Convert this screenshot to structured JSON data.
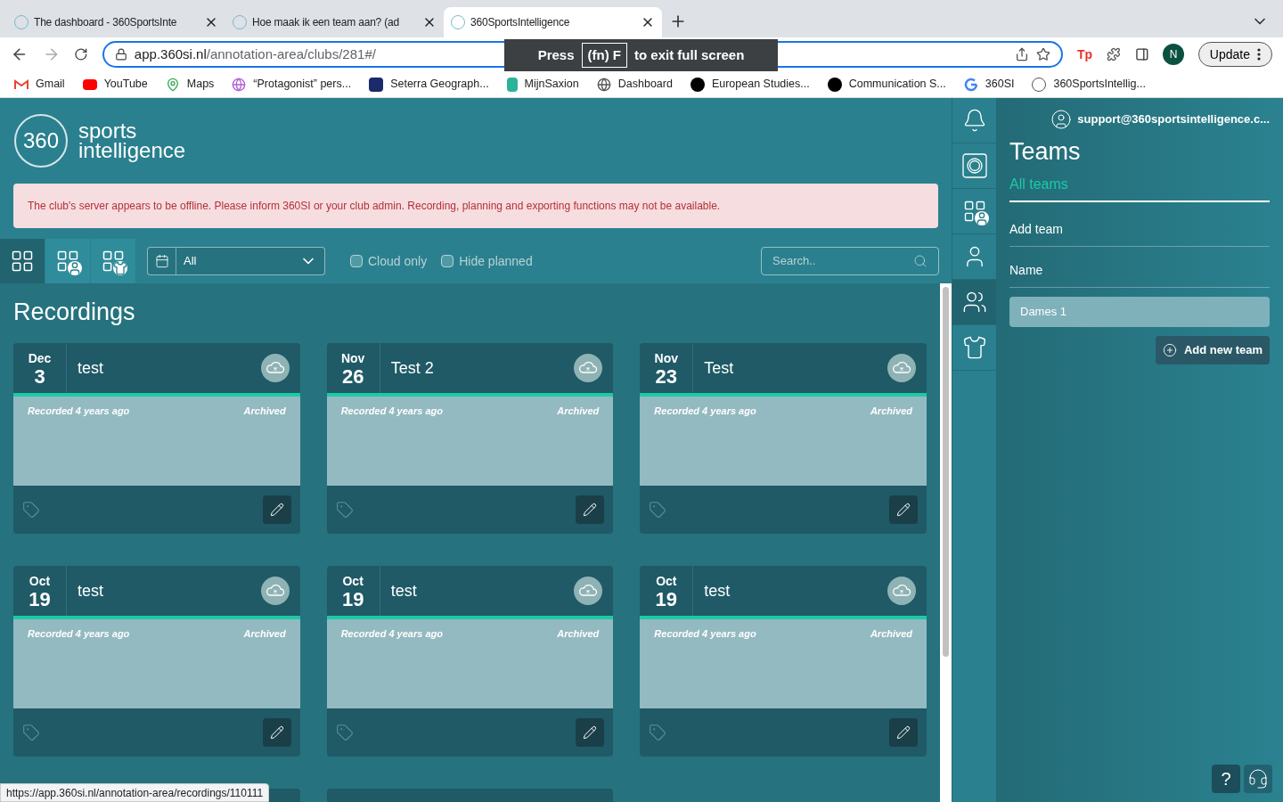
{
  "browser": {
    "tabs": [
      {
        "title": "The dashboard - 360SportsInte",
        "selected": false
      },
      {
        "title": "Hoe maak ik een team aan? (ad",
        "selected": false
      },
      {
        "title": "360SportsIntelligence",
        "selected": true
      }
    ],
    "address": {
      "host": "app.360si.nl",
      "path": "/annotation-area/clubs/281#/"
    },
    "profile": "N",
    "update": "Update",
    "tp": "Tp",
    "bookmarks": [
      "Gmail",
      "YouTube",
      "Maps",
      "“Protagonist” pers...",
      "Seterra Geograph...",
      "MijnSaxion",
      "Dashboard",
      "European Studies...",
      "Communication S...",
      "360SI",
      "360SportsIntellig..."
    ],
    "fullscreen_toast": {
      "before": "Press",
      "key": "(fn) F",
      "after": "to exit full screen"
    },
    "status_url": "https://app.360si.nl/annotation-area/recordings/110111"
  },
  "logo": {
    "mark": "360",
    "line1": "sports",
    "line2": "intelligence"
  },
  "alert": "The club's server appears to be offline. Please inform 360SI or your club admin. Recording, planning and exporting functions may not be available.",
  "view_buttons": [
    {
      "kind": "grid",
      "selected": true
    },
    {
      "kind": "players",
      "selected": false
    },
    {
      "kind": "teams",
      "selected": false
    }
  ],
  "period_select": {
    "value": "All"
  },
  "filters": [
    {
      "label": "Cloud only",
      "checked": false
    },
    {
      "label": "Hide planned",
      "checked": false
    }
  ],
  "search": {
    "placeholder": "Search.."
  },
  "heading": "Recordings",
  "recordings": [
    {
      "month": "Dec",
      "day": "3",
      "title": "test",
      "recorded": "Recorded 4 years ago",
      "status": "Archived"
    },
    {
      "month": "Nov",
      "day": "26",
      "title": "Test 2",
      "recorded": "Recorded 4 years ago",
      "status": "Archived"
    },
    {
      "month": "Nov",
      "day": "23",
      "title": "Test",
      "recorded": "Recorded 4 years ago",
      "status": "Archived"
    },
    {
      "month": "Oct",
      "day": "19",
      "title": "test",
      "recorded": "Recorded 4 years ago",
      "status": "Archived"
    },
    {
      "month": "Oct",
      "day": "19",
      "title": "test",
      "recorded": "Recorded 4 years ago",
      "status": "Archived"
    },
    {
      "month": "Oct",
      "day": "19",
      "title": "test",
      "recorded": "Recorded 4 years ago",
      "status": "Archived"
    }
  ],
  "rail": [
    {
      "kind": "bell",
      "selected": false
    },
    {
      "kind": "camera",
      "selected": false
    },
    {
      "kind": "players",
      "selected": false
    },
    {
      "kind": "person",
      "selected": false
    },
    {
      "kind": "team",
      "selected": true
    },
    {
      "kind": "shirt",
      "selected": false
    }
  ],
  "panel": {
    "user": "support@360sportsintelligence.c...",
    "title": "Teams",
    "tab": "All teams",
    "section": "Add team",
    "field_label": "Name",
    "field_value": "Dames 1",
    "button": "Add new team"
  },
  "help": "?"
}
